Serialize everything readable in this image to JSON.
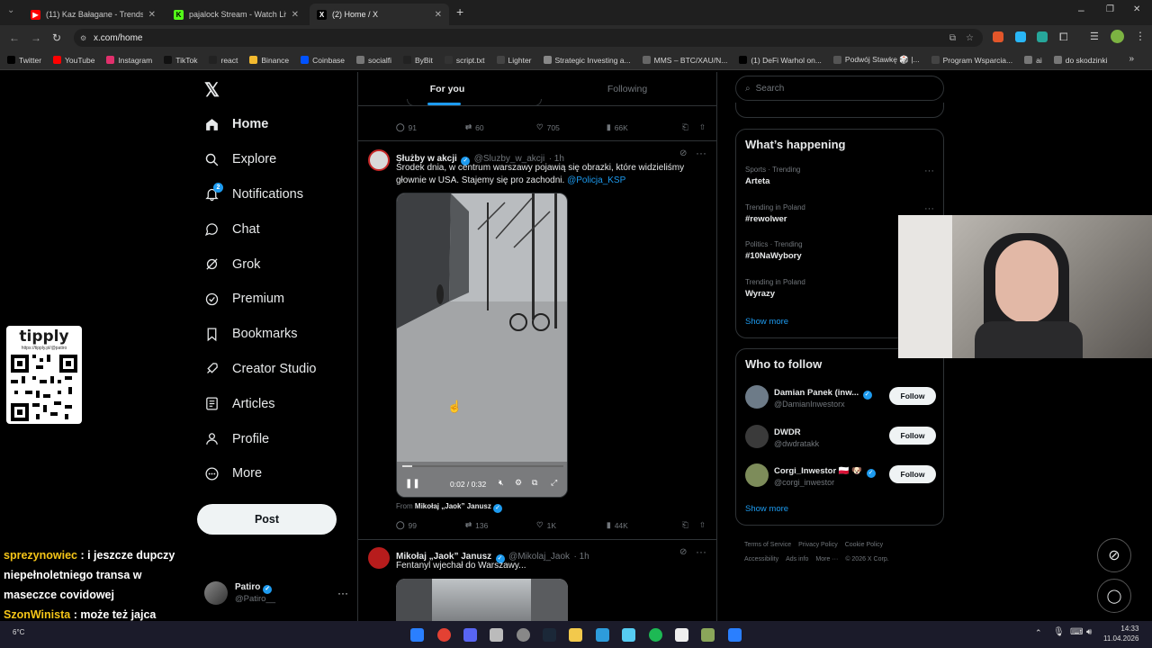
{
  "browser": {
    "tabs": [
      {
        "title": "(11) Kaz Bałagane - Trendsette",
        "fav": "youtube-icon"
      },
      {
        "title": "pajalock Stream - Watch Live o",
        "fav": "kick-icon"
      },
      {
        "title": "(2) Home / X",
        "fav": "x-icon"
      }
    ],
    "url": "x.com/home",
    "bookmarks": [
      "Twitter",
      "YouTube",
      "Instagram",
      "TikTok",
      "react",
      "Binance",
      "Coinbase",
      "socialfi",
      "ByBit",
      "script.txt",
      "Lighter",
      "Strategic Investing a...",
      "MMS – BTC/XAU/N...",
      "(1) DeFi Warhol on...",
      "Podwój Stawkę 🎲 |...",
      "Program Wsparcia...",
      "ai",
      "do skodzinki"
    ]
  },
  "nav": {
    "items": [
      {
        "label": "Home",
        "icon": "home-icon",
        "bold": true
      },
      {
        "label": "Explore",
        "icon": "search-icon"
      },
      {
        "label": "Notifications",
        "icon": "bell-icon",
        "badge": "2"
      },
      {
        "label": "Chat",
        "icon": "chat-icon"
      },
      {
        "label": "Grok",
        "icon": "grok-icon"
      },
      {
        "label": "Premium",
        "icon": "premium-icon"
      },
      {
        "label": "Bookmarks",
        "icon": "bookmark-icon"
      },
      {
        "label": "Creator Studio",
        "icon": "rocket-icon"
      },
      {
        "label": "Articles",
        "icon": "article-icon"
      },
      {
        "label": "Profile",
        "icon": "person-icon"
      },
      {
        "label": "More",
        "icon": "more-circle-icon"
      }
    ],
    "post_label": "Post",
    "account": {
      "name": "Patiro",
      "handle": "@Patiro__"
    }
  },
  "timeline": {
    "tabs": {
      "for_you": "For you",
      "following": "Following"
    },
    "prev_actions": {
      "replies": "91",
      "reposts": "60",
      "likes": "705",
      "views": "66K"
    },
    "tweet1": {
      "name": "Służby w akcji",
      "handle": "@Sluzby_w_akcji",
      "time": "· 1h",
      "text": "Środek dnia, w centrum warszawy pojawią się obrazki, które widzieliśmy głownie w USA. Stajemy się pro zachodni.",
      "mention": "@Policja_KSP",
      "video_time": "0:02 / 0:32",
      "from_label": "From",
      "from_name": "Mikołaj „Jaok” Janusz",
      "actions": {
        "replies": "99",
        "reposts": "136",
        "likes": "1K",
        "views": "44K"
      }
    },
    "tweet2": {
      "name": "Mikołaj „Jaok” Janusz",
      "handle": "@Mikolaj_Jaok",
      "time": "· 1h",
      "text": "Fentanyl wjechał do Warszawy..."
    }
  },
  "right": {
    "search_placeholder": "Search",
    "happening_title": "What’s happening",
    "trends": [
      {
        "meta": "Sports · Trending",
        "name": "Arteta"
      },
      {
        "meta": "Trending in Poland",
        "name": "#rewolwer"
      },
      {
        "meta": "Politics · Trending",
        "name": "#10NaWybory"
      },
      {
        "meta": "Trending in Poland",
        "name": "Wyrazy"
      }
    ],
    "show_more": "Show more",
    "follow_title": "Who to follow",
    "follow": [
      {
        "name": "Damian Panek (inw...",
        "handle": "@DamianInwestorx"
      },
      {
        "name": "DWDR",
        "handle": "@dwdratakk"
      },
      {
        "name": "Corgi_Inwestor 🇵🇱 🐶",
        "handle": "@corgi_inwestor"
      }
    ],
    "follow_label": "Follow",
    "footer": [
      "Terms of Service",
      "Privacy Policy",
      "Cookie Policy",
      "Accessibility",
      "Ads info",
      "More ···",
      "© 2026 X Corp."
    ]
  },
  "overlay": {
    "tipply": "tipply",
    "tipply_url": "https://tipply.pl/@patiro",
    "chat": [
      {
        "user": "sprezynowiec",
        "text": ": i jeszcze dupczy niepełnoletniego transa w maseczce covidowej"
      },
      {
        "user": "SzonWinista",
        "text": ": może też jajca odszczelić"
      }
    ]
  },
  "taskbar": {
    "time": "14:33",
    "date": "11.04.2026",
    "weather": "6°C"
  }
}
